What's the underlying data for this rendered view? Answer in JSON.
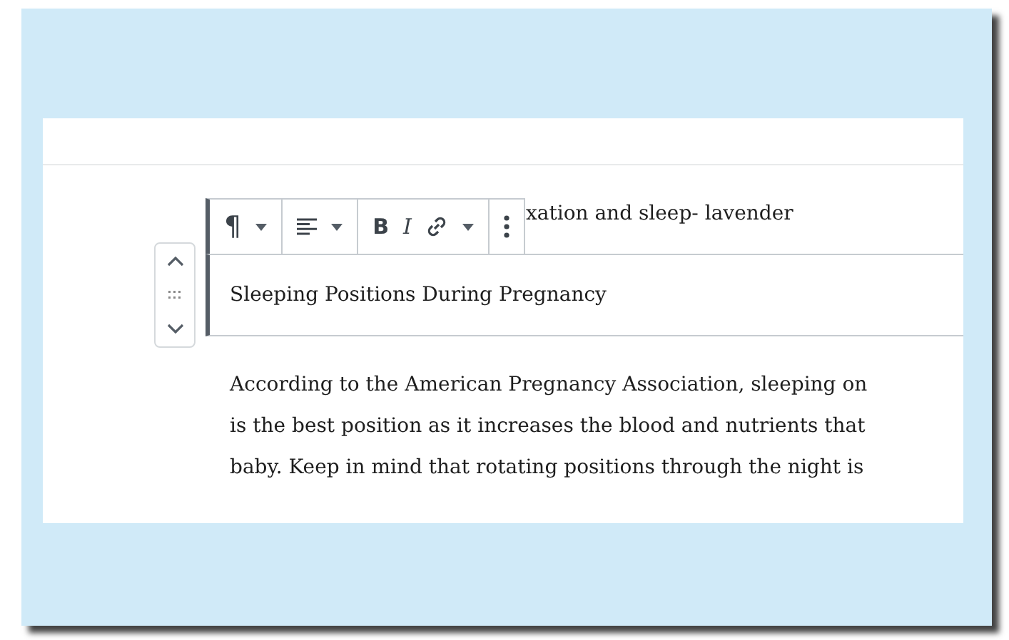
{
  "previous_block": {
    "text": "xation and sleep- lavender"
  },
  "toolbar": [
    {
      "items": [
        {
          "kind": "glyph",
          "label": "¶"
        },
        {
          "kind": "caret"
        }
      ]
    },
    {
      "items": [
        {
          "kind": "align"
        },
        {
          "kind": "caret"
        }
      ]
    },
    {
      "items": [
        {
          "kind": "bold",
          "label": "B"
        },
        {
          "kind": "italic",
          "label": "I"
        },
        {
          "kind": "link"
        },
        {
          "kind": "caret"
        }
      ]
    },
    {
      "items": [
        {
          "kind": "more"
        }
      ]
    }
  ],
  "heading_block": {
    "text": "Sleeping Positions During Pregnancy",
    "selected": true
  },
  "paragraph": {
    "lines": [
      "According to the American Pregnancy Association, sleeping on",
      "is the best position as it increases the blood and nutrients that",
      "baby. Keep in mind that rotating positions through the night is"
    ]
  }
}
